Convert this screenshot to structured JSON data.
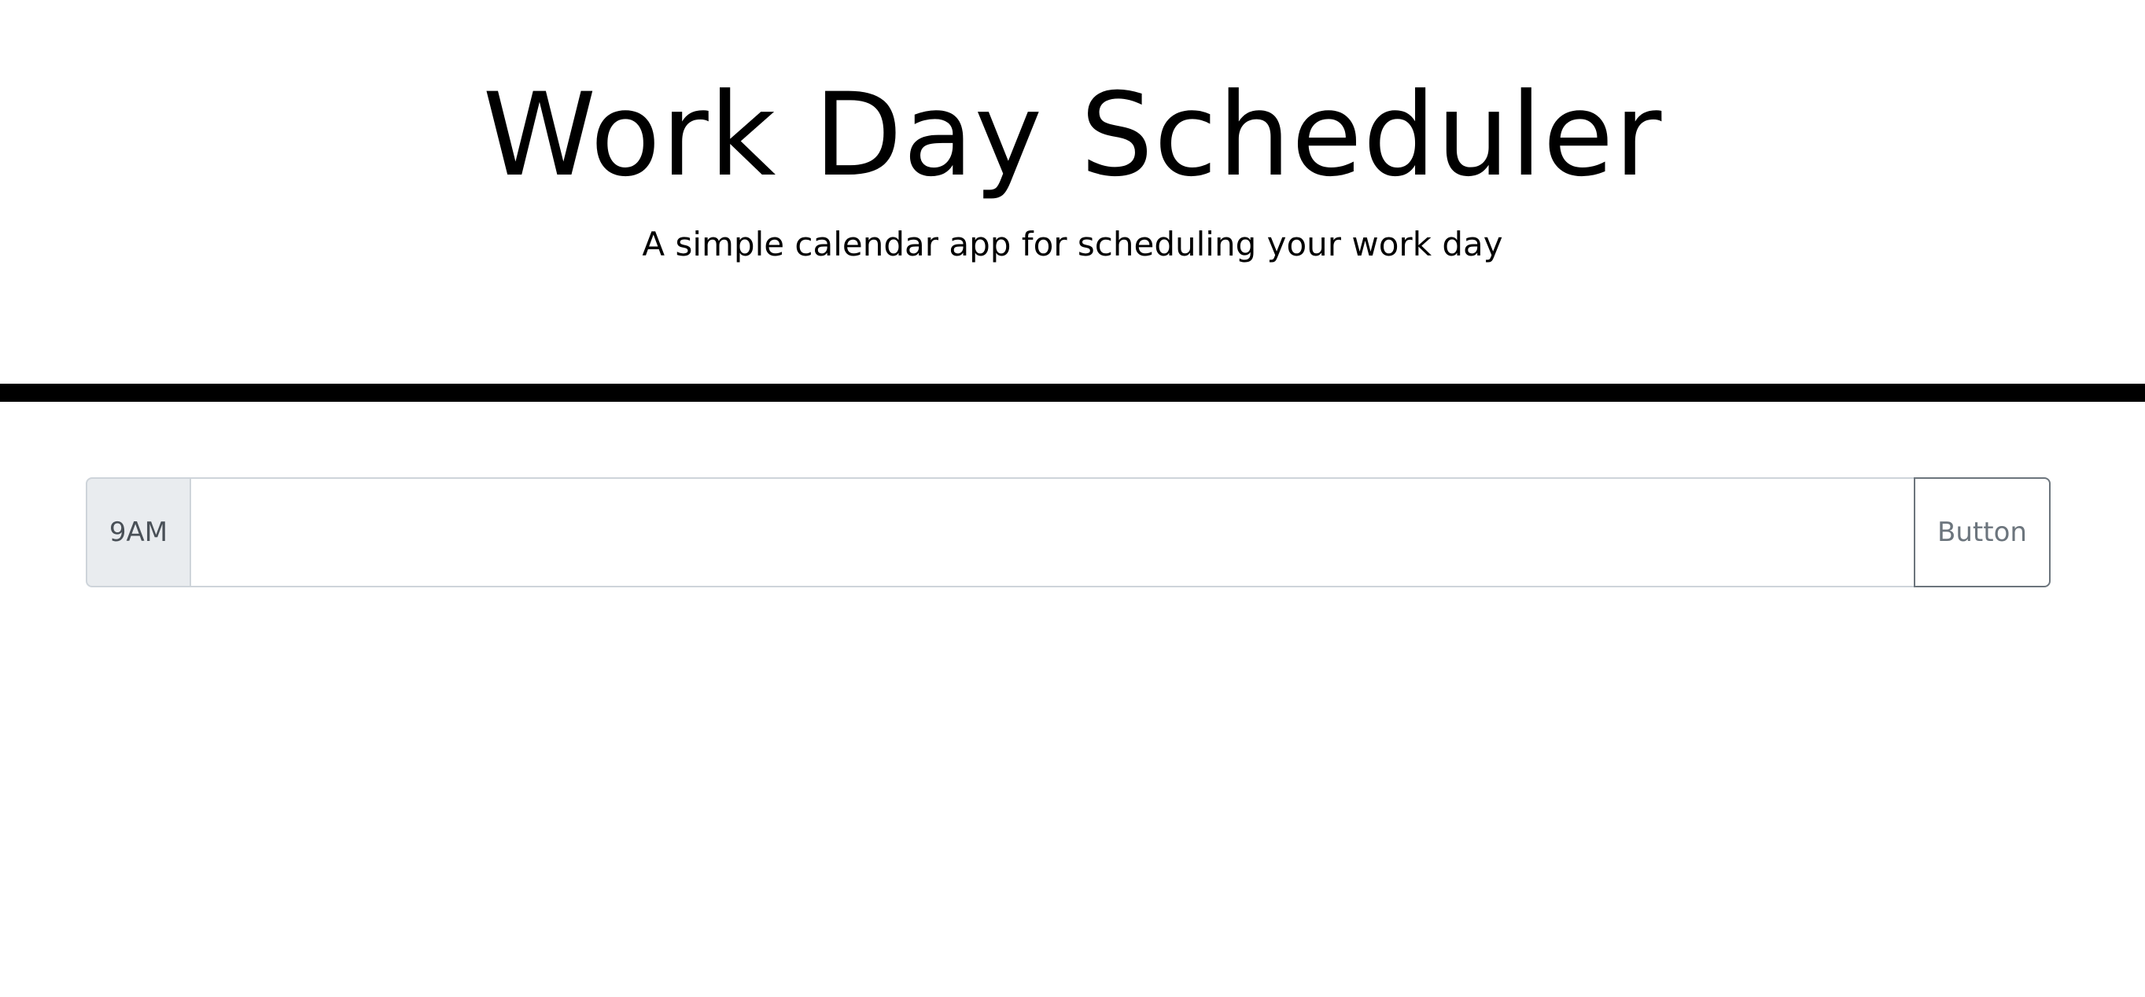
{
  "header": {
    "title": "Work Day Scheduler",
    "subtitle": "A simple calendar app for scheduling your work day"
  },
  "schedule": {
    "rows": [
      {
        "hour": "9AM",
        "description": "",
        "button_label": "Button"
      }
    ]
  },
  "colors": {
    "divider": "#000000",
    "hour_bg": "#e9ecef",
    "border": "#ced4da",
    "button_outline": "#6c757d"
  }
}
